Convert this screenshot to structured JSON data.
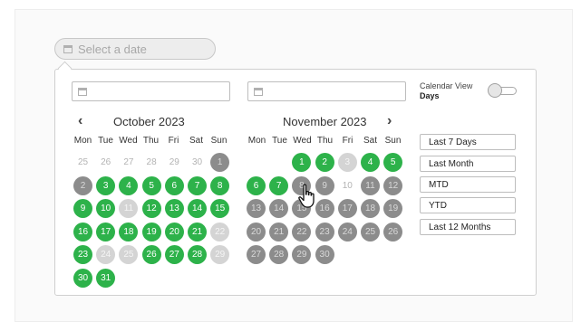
{
  "trigger": {
    "placeholder": "Select a date",
    "icon": "calendar-icon"
  },
  "inputs": {
    "start_value": "",
    "end_value": ""
  },
  "left_month": {
    "title": "October 2023",
    "weekdays": [
      "Mon",
      "Tue",
      "Wed",
      "Thu",
      "Fri",
      "Sat",
      "Sun"
    ],
    "days": [
      {
        "label": "25",
        "state": "plain"
      },
      {
        "label": "26",
        "state": "plain"
      },
      {
        "label": "27",
        "state": "plain"
      },
      {
        "label": "28",
        "state": "plain"
      },
      {
        "label": "29",
        "state": "plain"
      },
      {
        "label": "30",
        "state": "plain"
      },
      {
        "label": "1",
        "state": "gray"
      },
      {
        "label": "2",
        "state": "gray"
      },
      {
        "label": "3",
        "state": "green"
      },
      {
        "label": "4",
        "state": "green"
      },
      {
        "label": "5",
        "state": "green"
      },
      {
        "label": "6",
        "state": "green"
      },
      {
        "label": "7",
        "state": "green"
      },
      {
        "label": "8",
        "state": "green"
      },
      {
        "label": "9",
        "state": "green"
      },
      {
        "label": "10",
        "state": "green"
      },
      {
        "label": "11",
        "state": "light"
      },
      {
        "label": "12",
        "state": "green"
      },
      {
        "label": "13",
        "state": "green"
      },
      {
        "label": "14",
        "state": "green"
      },
      {
        "label": "15",
        "state": "green"
      },
      {
        "label": "16",
        "state": "green"
      },
      {
        "label": "17",
        "state": "green"
      },
      {
        "label": "18",
        "state": "green"
      },
      {
        "label": "19",
        "state": "green"
      },
      {
        "label": "20",
        "state": "green"
      },
      {
        "label": "21",
        "state": "green"
      },
      {
        "label": "22",
        "state": "light"
      },
      {
        "label": "23",
        "state": "green"
      },
      {
        "label": "24",
        "state": "light"
      },
      {
        "label": "25",
        "state": "light"
      },
      {
        "label": "26",
        "state": "green"
      },
      {
        "label": "27",
        "state": "green"
      },
      {
        "label": "28",
        "state": "green"
      },
      {
        "label": "29",
        "state": "light"
      },
      {
        "label": "30",
        "state": "green"
      },
      {
        "label": "31",
        "state": "green"
      }
    ]
  },
  "right_month": {
    "title": "November 2023",
    "weekdays": [
      "Mon",
      "Tue",
      "Wed",
      "Thu",
      "Fri",
      "Sat",
      "Sun"
    ],
    "days": [
      {
        "label": "",
        "state": "empty"
      },
      {
        "label": "",
        "state": "empty"
      },
      {
        "label": "1",
        "state": "green"
      },
      {
        "label": "2",
        "state": "green"
      },
      {
        "label": "3",
        "state": "light"
      },
      {
        "label": "4",
        "state": "green"
      },
      {
        "label": "5",
        "state": "green"
      },
      {
        "label": "6",
        "state": "green"
      },
      {
        "label": "7",
        "state": "green"
      },
      {
        "label": "8",
        "state": "gray"
      },
      {
        "label": "9",
        "state": "gray"
      },
      {
        "label": "10",
        "state": "plain"
      },
      {
        "label": "11",
        "state": "gray"
      },
      {
        "label": "12",
        "state": "gray"
      },
      {
        "label": "13",
        "state": "gray"
      },
      {
        "label": "14",
        "state": "gray"
      },
      {
        "label": "15",
        "state": "gray"
      },
      {
        "label": "16",
        "state": "gray"
      },
      {
        "label": "17",
        "state": "gray"
      },
      {
        "label": "18",
        "state": "gray"
      },
      {
        "label": "19",
        "state": "gray"
      },
      {
        "label": "20",
        "state": "gray"
      },
      {
        "label": "21",
        "state": "gray"
      },
      {
        "label": "22",
        "state": "gray"
      },
      {
        "label": "23",
        "state": "gray"
      },
      {
        "label": "24",
        "state": "gray"
      },
      {
        "label": "25",
        "state": "gray"
      },
      {
        "label": "26",
        "state": "gray"
      },
      {
        "label": "27",
        "state": "gray"
      },
      {
        "label": "28",
        "state": "gray"
      },
      {
        "label": "29",
        "state": "gray"
      },
      {
        "label": "30",
        "state": "gray"
      }
    ]
  },
  "view_toggle": {
    "label": "Calendar View",
    "value": "Days",
    "on": false
  },
  "quick_ranges": [
    "Last 7 Days",
    "Last Month",
    "MTD",
    "YTD",
    "Last 12 Months"
  ],
  "colors": {
    "available": "#2db24a",
    "unavailable": "#8c8c8c",
    "disabled": "#d4d4d4"
  }
}
